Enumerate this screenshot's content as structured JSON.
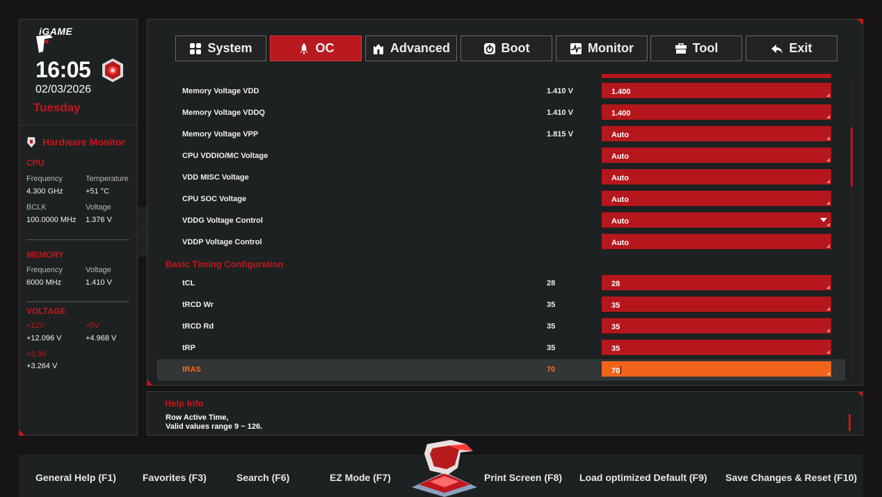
{
  "brand": {
    "logo_text": "iGAME"
  },
  "clock": {
    "time": "16:05",
    "date": "02/03/2026",
    "day": "Tuesday"
  },
  "hardware_monitor": {
    "title": "Hardware Monitor",
    "cpu": {
      "title": "CPU",
      "frequency_label": "Frequency",
      "frequency": "4.300 GHz",
      "temperature_label": "Temperature",
      "temperature": "+51 °C",
      "bclk_label": "BCLK",
      "bclk": "100.0000 MHz",
      "voltage_label": "Voltage",
      "voltage": "1.376 V"
    },
    "memory": {
      "title": "MEMORY",
      "frequency_label": "Frequency",
      "frequency": "6000 MHz",
      "voltage_label": "Voltage",
      "voltage": "1.410 V"
    },
    "voltage": {
      "title": "VOLTAGE",
      "v12_label": "+12V",
      "v12": "+12.096 V",
      "v5_label": "+5V",
      "v5": "+4.968 V",
      "v33_label": "+3.3V",
      "v33": "+3.264 V"
    }
  },
  "tabs": [
    {
      "label": "System",
      "icon": "grid-icon"
    },
    {
      "label": "OC",
      "icon": "rocket-icon",
      "active": true
    },
    {
      "label": "Advanced",
      "icon": "castle-icon"
    },
    {
      "label": "Boot",
      "icon": "power-icon"
    },
    {
      "label": "Monitor",
      "icon": "pulse-icon"
    },
    {
      "label": "Tool",
      "icon": "toolbox-icon"
    },
    {
      "label": "Exit",
      "icon": "return-arrow-icon"
    }
  ],
  "settings": [
    {
      "label": "Memory Voltage VDD",
      "current": "1.410 V",
      "value": "1.400"
    },
    {
      "label": "Memory Voltage VDDQ",
      "current": "1.410 V",
      "value": "1.400"
    },
    {
      "label": "Memory Voltage VPP",
      "current": "1.815 V",
      "value": "Auto"
    },
    {
      "label": "CPU VDDIO/MC Voltage",
      "current": "",
      "value": "Auto"
    },
    {
      "label": "VDD MISC Voltage",
      "current": "",
      "value": "Auto"
    },
    {
      "label": "CPU SOC Voltage",
      "current": "",
      "value": "Auto"
    },
    {
      "label": "VDDG Voltage Control",
      "current": "",
      "value": "Auto",
      "dropdown": true
    },
    {
      "label": "VDDP Voltage Control",
      "current": "",
      "value": "Auto"
    }
  ],
  "timing_section": {
    "title": "Basic Timing Configuration"
  },
  "timings": [
    {
      "label": "tCL",
      "current": "28",
      "value": "28"
    },
    {
      "label": "tRCD Wr",
      "current": "35",
      "value": "35"
    },
    {
      "label": "tRCD Rd",
      "current": "35",
      "value": "35"
    },
    {
      "label": "tRP",
      "current": "35",
      "value": "35"
    },
    {
      "label": "tRAS",
      "current": "70",
      "value": "70",
      "selected": true
    }
  ],
  "help": {
    "title": "Help Info",
    "line1": "Row Active Time,",
    "line2": "Valid values range 9 ~ 126."
  },
  "function_keys": [
    "General Help (F1)",
    "Favorites (F3)",
    "Search (F6)",
    "EZ Mode (F7)",
    "Print Screen (F8)",
    "Load optimized Default (F9)",
    "Save Changes & Reset (F10)"
  ],
  "colors": {
    "accent": "#c4161c",
    "selected": "#f0641a",
    "panel": "#1e2121"
  }
}
